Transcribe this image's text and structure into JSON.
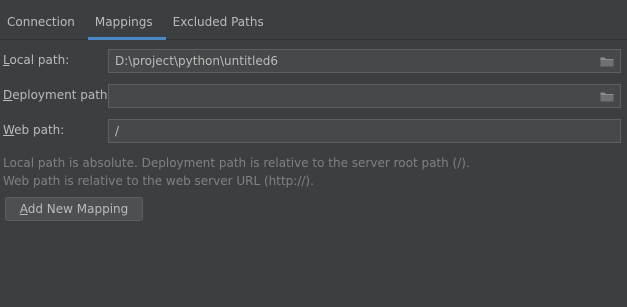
{
  "tabs": [
    {
      "label": "Connection"
    },
    {
      "label": "Mappings"
    },
    {
      "label": "Excluded Paths"
    }
  ],
  "active_tab": "Mappings",
  "local_path": {
    "label_mn": "L",
    "label_rest": "ocal path:",
    "value": "D:\\project\\python\\untitled6"
  },
  "deployment_path": {
    "label_mn": "D",
    "label_rest": "eployment path:",
    "value": ""
  },
  "web_path": {
    "label_mn": "W",
    "label_rest": "eb path:",
    "value": "/"
  },
  "hint_line1": "Local path is absolute. Deployment path is relative to the server root path (/).",
  "hint_line2": "Web path is relative to the web server URL (http://).",
  "add_button": {
    "mn": "A",
    "rest": "dd New Mapping"
  },
  "colors": {
    "background": "#3c3f41",
    "accent": "#4a88c7",
    "field_bg": "#45494a"
  }
}
